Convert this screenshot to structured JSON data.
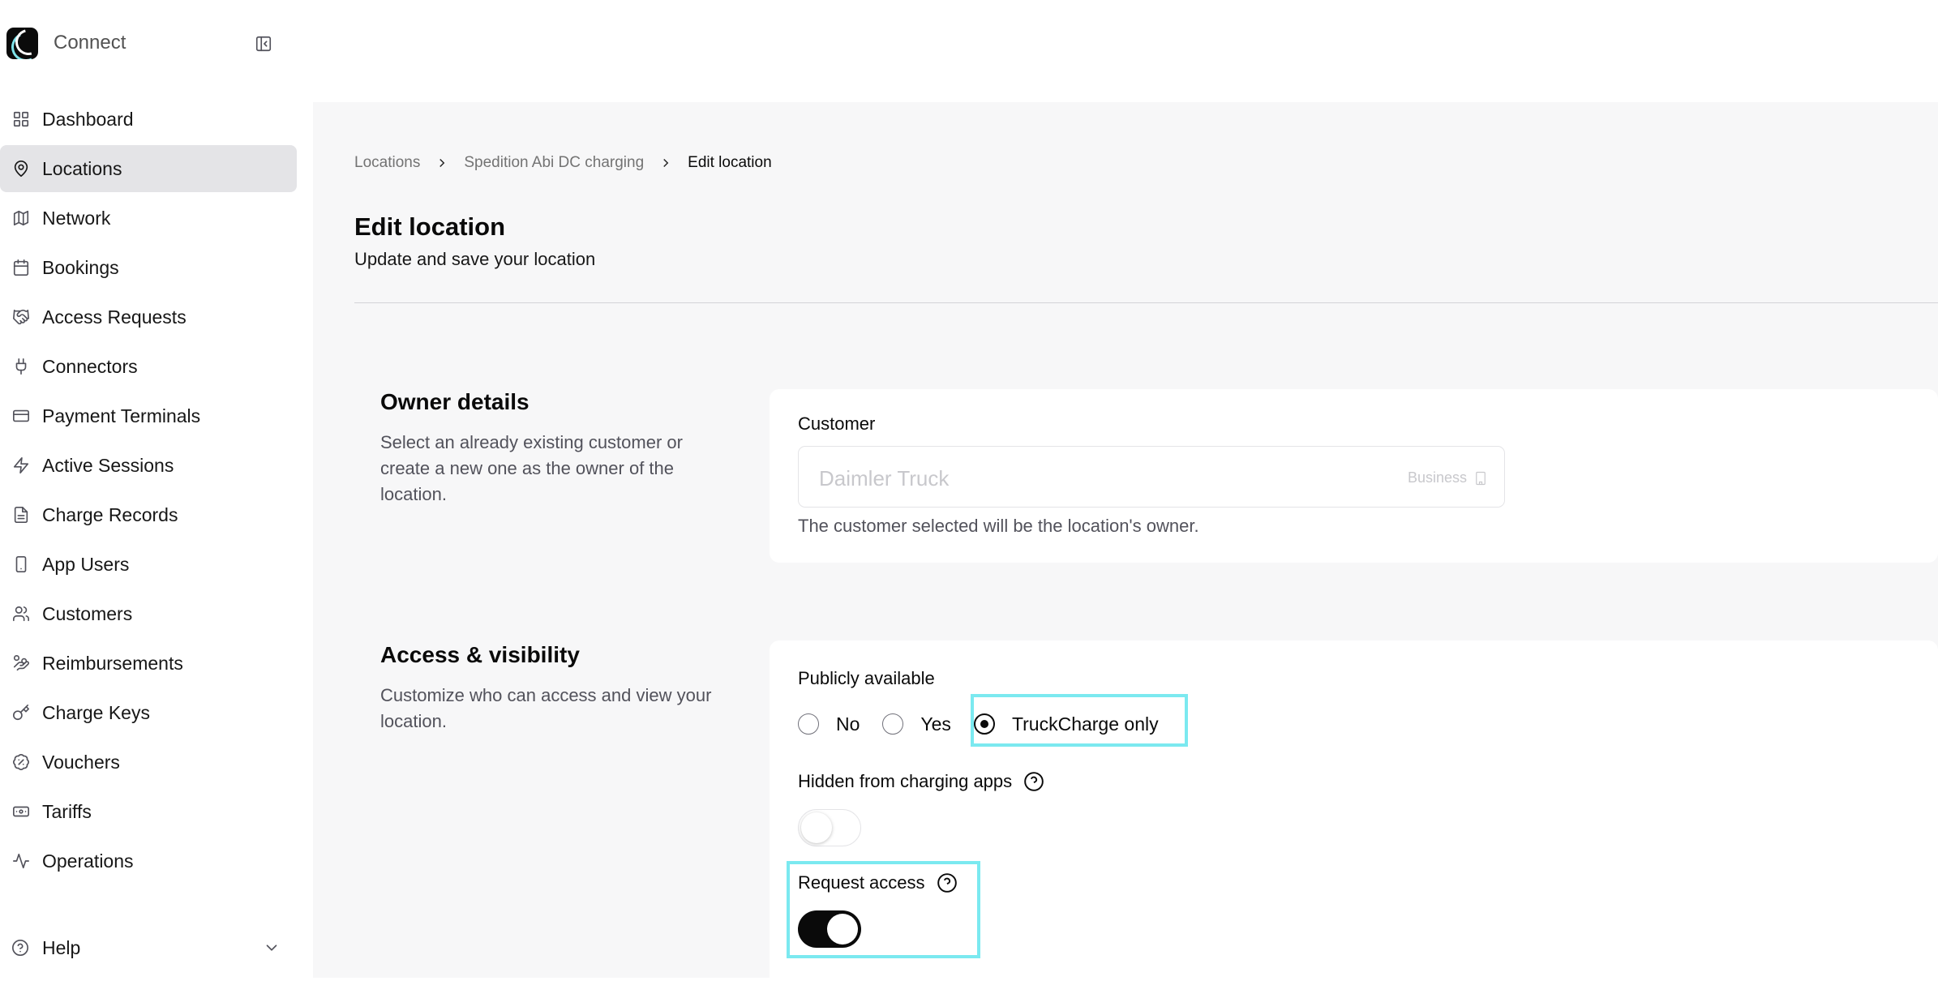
{
  "app": {
    "name": "Connect",
    "logo_icon": "app-logo-icon"
  },
  "sidebar": {
    "items": [
      {
        "label": "Dashboard",
        "icon": "grid-icon",
        "active": false
      },
      {
        "label": "Locations",
        "icon": "map-pin-icon",
        "active": true
      },
      {
        "label": "Network",
        "icon": "map-icon",
        "active": false
      },
      {
        "label": "Bookings",
        "icon": "calendar-icon",
        "active": false
      },
      {
        "label": "Access Requests",
        "icon": "handshake-icon",
        "active": false
      },
      {
        "label": "Connectors",
        "icon": "plug-icon",
        "active": false
      },
      {
        "label": "Payment Terminals",
        "icon": "credit-card-icon",
        "active": false
      },
      {
        "label": "Active Sessions",
        "icon": "zap-icon",
        "active": false
      },
      {
        "label": "Charge Records",
        "icon": "file-icon",
        "active": false
      },
      {
        "label": "App Users",
        "icon": "smartphone-icon",
        "active": false
      },
      {
        "label": "Customers",
        "icon": "users-icon",
        "active": false
      },
      {
        "label": "Reimbursements",
        "icon": "hand-coins-icon",
        "active": false
      },
      {
        "label": "Charge Keys",
        "icon": "key-icon",
        "active": false
      },
      {
        "label": "Vouchers",
        "icon": "badge-percent-icon",
        "active": false
      },
      {
        "label": "Tariffs",
        "icon": "banknote-icon",
        "active": false
      },
      {
        "label": "Operations",
        "icon": "activity-icon",
        "active": false
      }
    ],
    "help_label": "Help"
  },
  "breadcrumb": {
    "items": [
      "Locations",
      "Spedition Abi DC charging"
    ],
    "current": "Edit location"
  },
  "page": {
    "title": "Edit location",
    "subtitle": "Update and save your location"
  },
  "owner_section": {
    "title": "Owner details",
    "description": "Select an already existing customer or create a new one as the owner of the location.",
    "customer_label": "Customer",
    "customer_value": "Daimler Truck",
    "customer_type": "Business",
    "helper_text": "The customer selected will be the location's owner."
  },
  "access_section": {
    "title": "Access & visibility",
    "description": "Customize who can access and view your location.",
    "publicly_available_label": "Publicly available",
    "options": [
      "No",
      "Yes",
      "TruckCharge only"
    ],
    "selected_option": "TruckCharge only",
    "hidden_label": "Hidden from charging apps",
    "hidden_value": false,
    "request_access_label": "Request access",
    "request_access_value": true
  },
  "colors": {
    "highlight": "#7be9f0",
    "active_nav": "#e4e4e7",
    "toggle_on": "#0a0a0a"
  }
}
